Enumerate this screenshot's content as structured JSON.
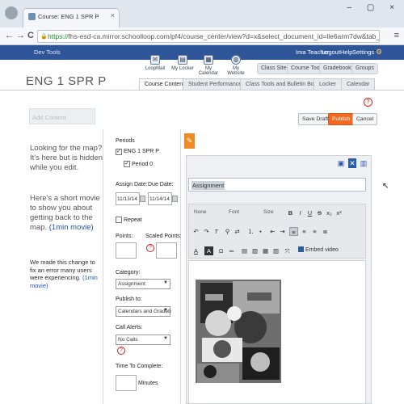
{
  "browser": {
    "tab_title": "Course: ENG 1 SPR P",
    "tab_close": "×",
    "window_controls": "– ▢ ×",
    "url_prefix": "https://",
    "url_rest": "fhs-esd-ca.mirror.schoolloop.com/pf4/course_center/view?d=x&select_document_id=lle6arm7dw&tab_module=course_curr",
    "nav_back": "←",
    "nav_forward": "→",
    "nav_reload": "C",
    "menu_glyph": "≡",
    "lock_glyph": "🔒"
  },
  "appbar": {
    "dev_tools": "Dev Tools",
    "user_name": "Ima Teacher",
    "logout": "Logout",
    "help": "Help",
    "settings": "Settings",
    "settings_icon": "gear-icon"
  },
  "top_icons": [
    {
      "label": "LoopMail",
      "icon": "mail-icon"
    },
    {
      "label": "My Locker",
      "icon": "locker-icon"
    },
    {
      "label": "My Calendar",
      "icon": "calendar-icon"
    },
    {
      "label": "My Website",
      "icon": "globe-icon"
    }
  ],
  "pills": [
    "Class Sites",
    "Course Tools",
    "Gradebooks",
    "Groups"
  ],
  "course_title": "ENG 1 SPR P",
  "tabs": [
    {
      "label": "Course Content",
      "active": true
    },
    {
      "label": "Student Performance",
      "active": false
    },
    {
      "label": "Class Tools and Bulletin Board",
      "active": false
    },
    {
      "label": "Locker",
      "active": false
    },
    {
      "label": "Calendar",
      "active": false
    }
  ],
  "add_content_placeholder": "Add Content",
  "buttons": {
    "save_draft": "Save Draft",
    "publish": "Publish",
    "cancel": "Cancel"
  },
  "help_glyph": "?",
  "sidebar": {
    "map_text": "Looking for the map? It's here but is hidden while you edit.",
    "movie_text": "Here's a short movie to show you about getting back to the map.",
    "movie_link": "(1min movie)",
    "notice_text": "We made this change to fix an error many users were experiencing.",
    "notice_link": "(1min movie)"
  },
  "form": {
    "periods_label": "Periods",
    "period_1": "ENG 1 SPR P",
    "period_1_sub": "Period 0",
    "check_glyph": "✓",
    "assign_date_label": "Assign Date:",
    "due_date_label": "Due Date:",
    "assign_date": "11/13/14",
    "due_date": "11/14/14",
    "repeat_label": "Repeat",
    "points_label": "Points:",
    "scaled_points_label": "Scaled Points:",
    "category_label": "Category:",
    "category_value": "Assignment",
    "publish_to_label": "Publish to:",
    "publish_to_value": "Calendars and Gradeb",
    "call_alerts_label": "Call Alerts:",
    "call_alerts_value": "No Calls",
    "time_label": "Time To Complete:",
    "minutes": "Minutes"
  },
  "editor": {
    "title_value": "Assignment",
    "font_style": "None",
    "font": "Font",
    "size": "Size",
    "embed_video": "Embed video",
    "action_icons": [
      "save-icon",
      "close-icon",
      "trash-icon"
    ]
  }
}
